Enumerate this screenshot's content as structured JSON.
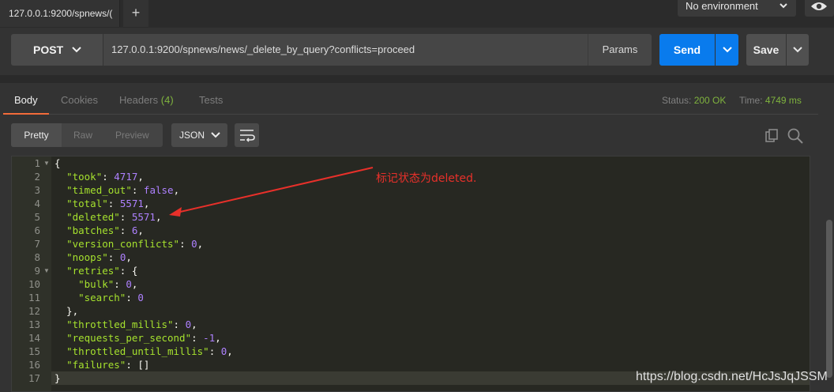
{
  "tabbar": {
    "active_tab": "127.0.0.1:9200/spnews/(",
    "new_tab_icon": "plus-icon",
    "environment": "No environment"
  },
  "request": {
    "method": "POST",
    "url": "127.0.0.1:9200/spnews/news/_delete_by_query?conflicts=proceed",
    "params_label": "Params",
    "send_label": "Send",
    "save_label": "Save",
    "accent": "#097bed"
  },
  "response": {
    "tabs": {
      "body": "Body",
      "cookies": "Cookies",
      "headers": "Headers",
      "headers_count": "(4)",
      "tests": "Tests"
    },
    "status_label": "Status:",
    "status_value": "200 OK",
    "time_label": "Time:",
    "time_value": "4749 ms",
    "format_tabs": [
      "Pretty",
      "Raw",
      "Preview"
    ],
    "format_selected": "JSON"
  },
  "code_lines": [
    {
      "n": "1",
      "fold": true
    },
    {
      "n": "2"
    },
    {
      "n": "3"
    },
    {
      "n": "4"
    },
    {
      "n": "5"
    },
    {
      "n": "6"
    },
    {
      "n": "7"
    },
    {
      "n": "8"
    },
    {
      "n": "9",
      "fold": true
    },
    {
      "n": "10"
    },
    {
      "n": "11"
    },
    {
      "n": "12"
    },
    {
      "n": "13"
    },
    {
      "n": "14"
    },
    {
      "n": "15"
    },
    {
      "n": "16"
    },
    {
      "n": "17"
    }
  ],
  "json_body": {
    "took": "4717",
    "timed_out": "false",
    "total": "5571",
    "deleted": "5571",
    "batches": "6",
    "version_conflicts": "0",
    "noops": "0",
    "bulk": "0",
    "search": "0",
    "throttled_millis": "0",
    "requests_per_second": "-1",
    "throttled_until_millis": "0",
    "failures": "[]"
  },
  "annotation": "标记状态为deleted.",
  "watermark": "https://blog.csdn.net/HcJsJqJSSM",
  "colors": {
    "status_ok": "#7fb33e",
    "annotation": "#e8302a",
    "active_tab_underline": "#f26b3a"
  }
}
